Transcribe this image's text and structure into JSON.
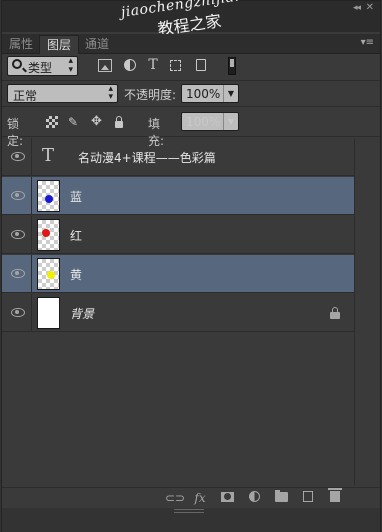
{
  "watermark": {
    "line1": "jiaochengzhijia.com",
    "line2": "教程之家"
  },
  "window": {
    "collapse_glyph": "◂◂",
    "close_glyph": "✕",
    "menu_glyph": "▾≡"
  },
  "tabs": [
    {
      "label": "属性",
      "active": false
    },
    {
      "label": "图层",
      "active": true
    },
    {
      "label": "通道",
      "active": false
    }
  ],
  "filter": {
    "kind_label": "类型",
    "icons": [
      "image-filter-icon",
      "adjustment-filter-icon",
      "type-filter-icon",
      "shape-filter-icon",
      "smart-object-filter-icon"
    ],
    "type_glyph": "T"
  },
  "blend": {
    "mode": "正常",
    "opacity_label": "不透明度:",
    "opacity_value": "100%"
  },
  "lock": {
    "label": "锁定:",
    "fill_label": "填充:",
    "fill_value": "100%"
  },
  "layers": [
    {
      "name": "名动漫4+课程——色彩篇",
      "kind": "text",
      "glyph": "T",
      "selected": false
    },
    {
      "name": "蓝",
      "kind": "pixel",
      "dot_color": "#1a1ad6",
      "selected": true
    },
    {
      "name": "红",
      "kind": "pixel",
      "dot_color": "#e01818",
      "selected": false
    },
    {
      "name": "黄",
      "kind": "pixel",
      "dot_color": "#f0f000",
      "selected": true
    },
    {
      "name": "背景",
      "kind": "background",
      "locked": true,
      "selected": false
    }
  ],
  "footer": {
    "fx_label": "fx"
  },
  "colors": {
    "selected_row": "#57677d",
    "panel_bg": "#3a3a3a"
  }
}
